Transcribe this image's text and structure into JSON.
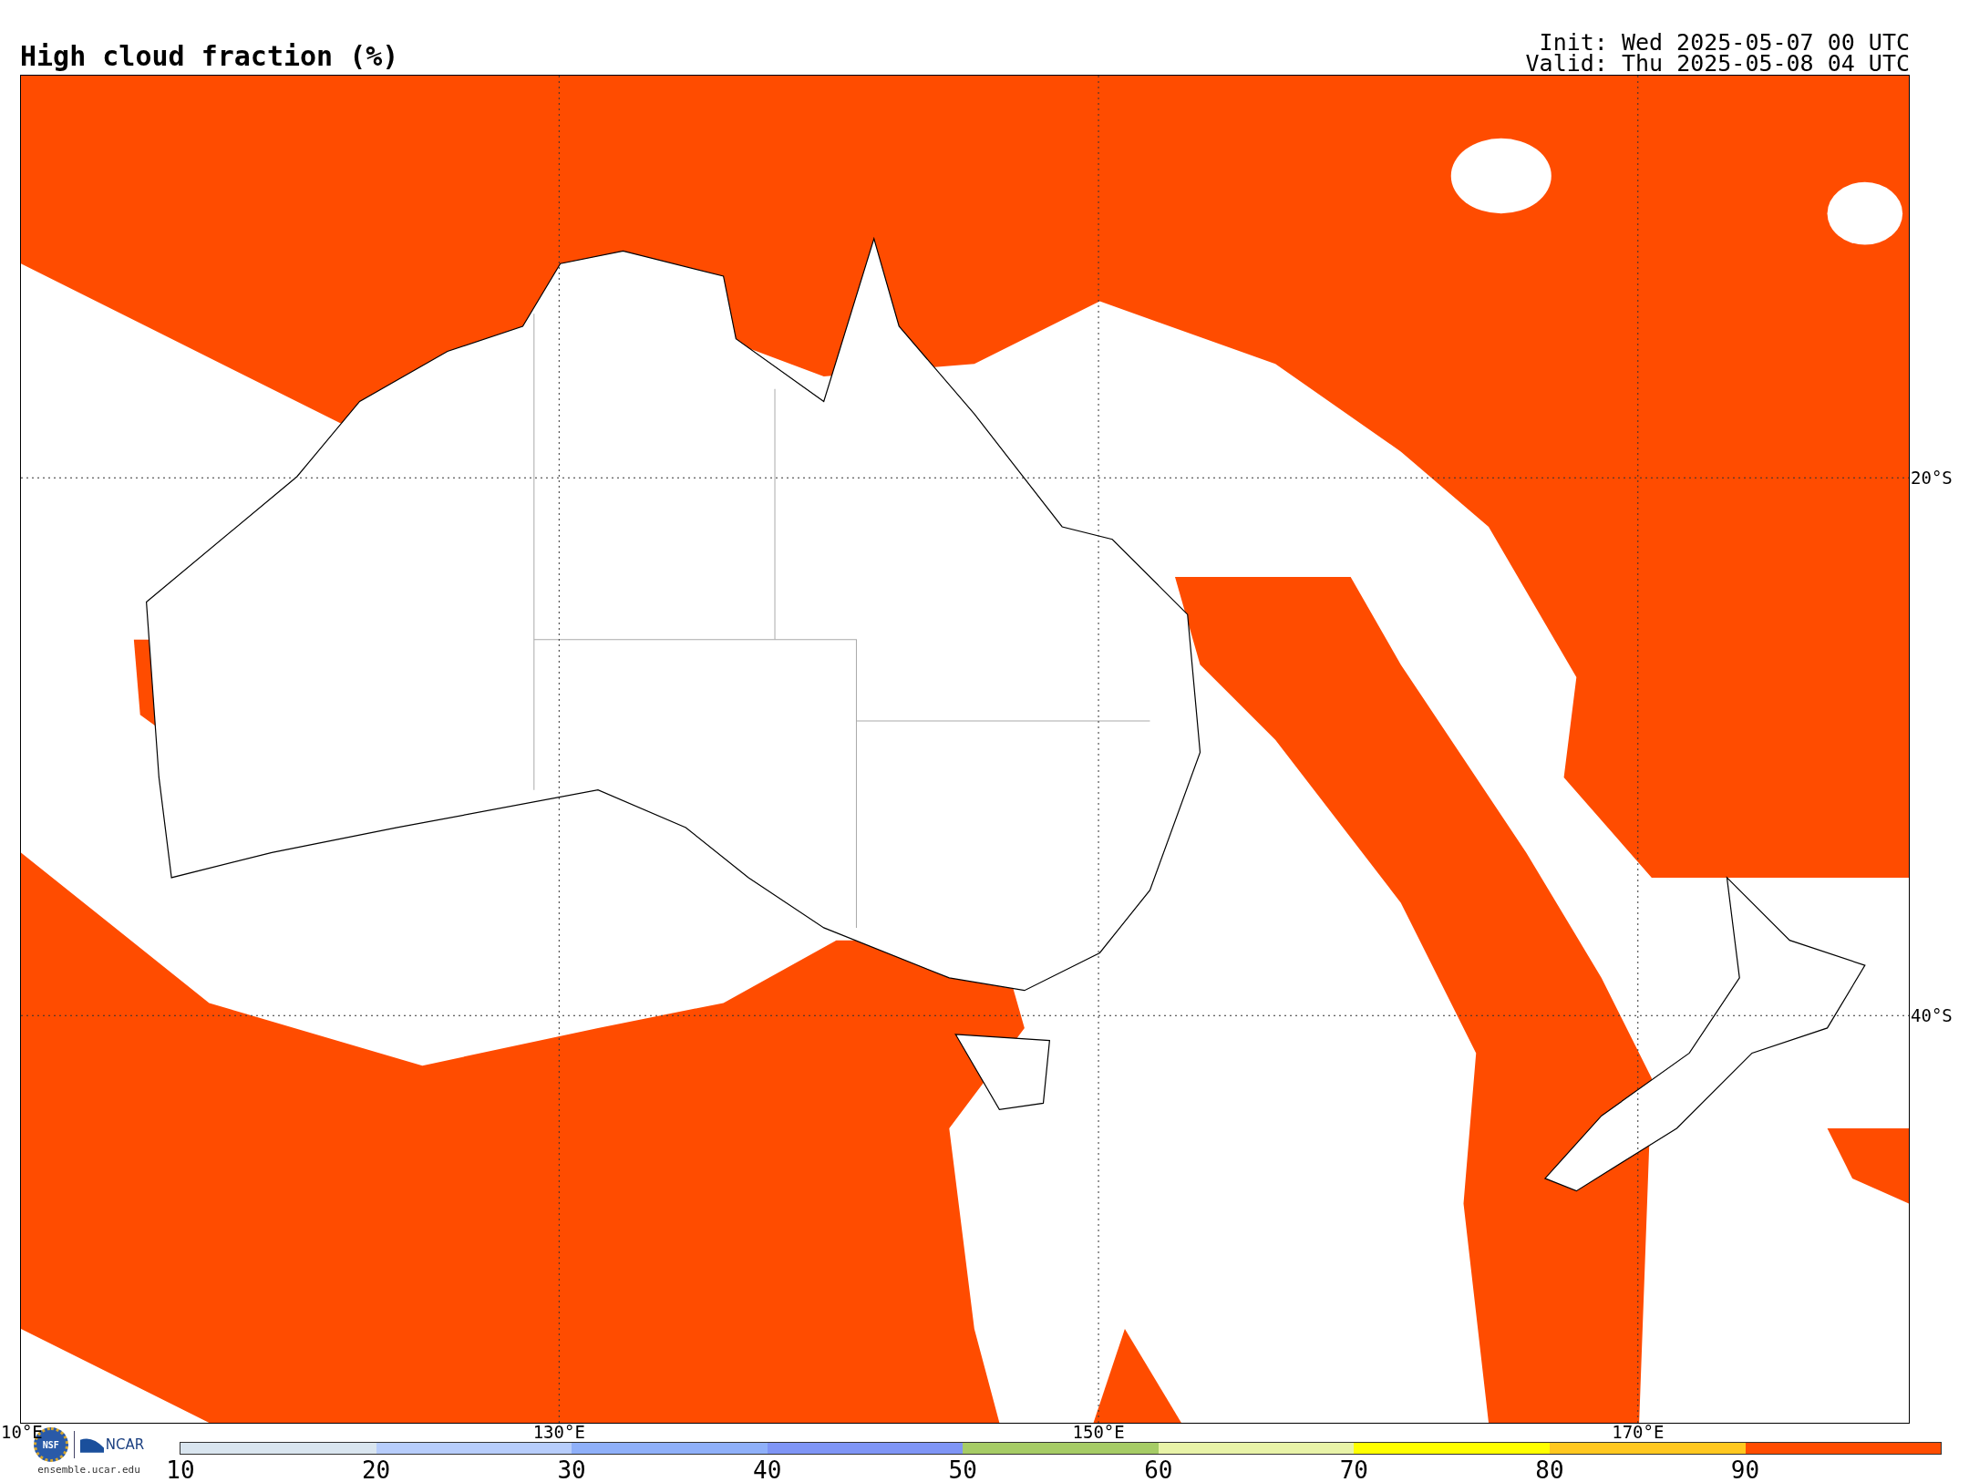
{
  "title": "High cloud fraction (%)",
  "run_info": {
    "init": "Init: Wed 2025-05-07 00 UTC",
    "valid": "Valid: Thu 2025-05-08 04 UTC"
  },
  "map": {
    "lon_labels": [
      "10°E",
      "130°E",
      "150°E",
      "170°E"
    ],
    "lat_labels": [
      "20°S",
      "40°S"
    ]
  },
  "logo": {
    "org_1": "NSF",
    "org_2": "NCAR",
    "url": "ensemble.ucar.edu"
  },
  "colorbar": [
    {
      "label": "10",
      "color": "#d9e5ef"
    },
    {
      "label": "20",
      "color": "#b7cdfb"
    },
    {
      "label": "30",
      "color": "#8fb0f9"
    },
    {
      "label": "40",
      "color": "#7f95f5"
    },
    {
      "label": "50",
      "color": "#a6cc66"
    },
    {
      "label": "60",
      "color": "#e8f3a8"
    },
    {
      "label": "70",
      "color": "#ffff00"
    },
    {
      "label": "80",
      "color": "#ffc820"
    },
    {
      "label": "90",
      "color": "#ff4c00"
    }
  ]
}
